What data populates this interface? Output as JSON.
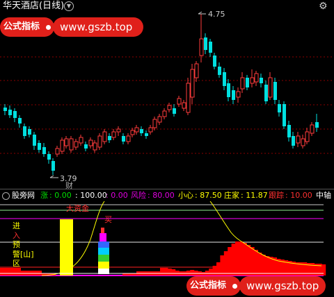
{
  "window": {
    "title": "华天酒店(日线)"
  },
  "banner_top": {
    "label": "公式指标",
    "url": "www.gszb.top"
  },
  "banner_bottom": {
    "label": "公式指标",
    "url": "www.gszb.top"
  },
  "price_chart": {
    "high_label": "4.75",
    "low_label": "3.79",
    "annotation_cai": "财"
  },
  "indicator": {
    "name": "股旁网",
    "items": [
      {
        "label": "涨",
        "value": "0.00",
        "color": "#00e000"
      },
      {
        "label": "",
        "value": "100.00",
        "color": "#ffffff",
        "prefix": ": "
      },
      {
        "label": "",
        "value": "0.00",
        "color": "#e000e0",
        "prefix": ": "
      },
      {
        "label": "风险",
        "value": "80.00",
        "color": "#e000e0"
      },
      {
        "label": "小心",
        "value": "87.50",
        "color": "#ffff00"
      },
      {
        "label": "庄家",
        "value": "11.87",
        "color": "#ffff00"
      },
      {
        "label": "跟踪",
        "value": "10.00",
        "color": "#ff3030"
      }
    ],
    "trailing": "中轴",
    "labels": {
      "big_fund": "大资金",
      "buy": "买",
      "jin": "进",
      "ru": "入",
      "yu": "预",
      "jing": "警[山]",
      "qu": "区"
    }
  },
  "colors": {
    "up": "#ff3c3c",
    "down": "#00e0e0",
    "grid": "#8b0000",
    "accent": "#e0201a"
  }
}
